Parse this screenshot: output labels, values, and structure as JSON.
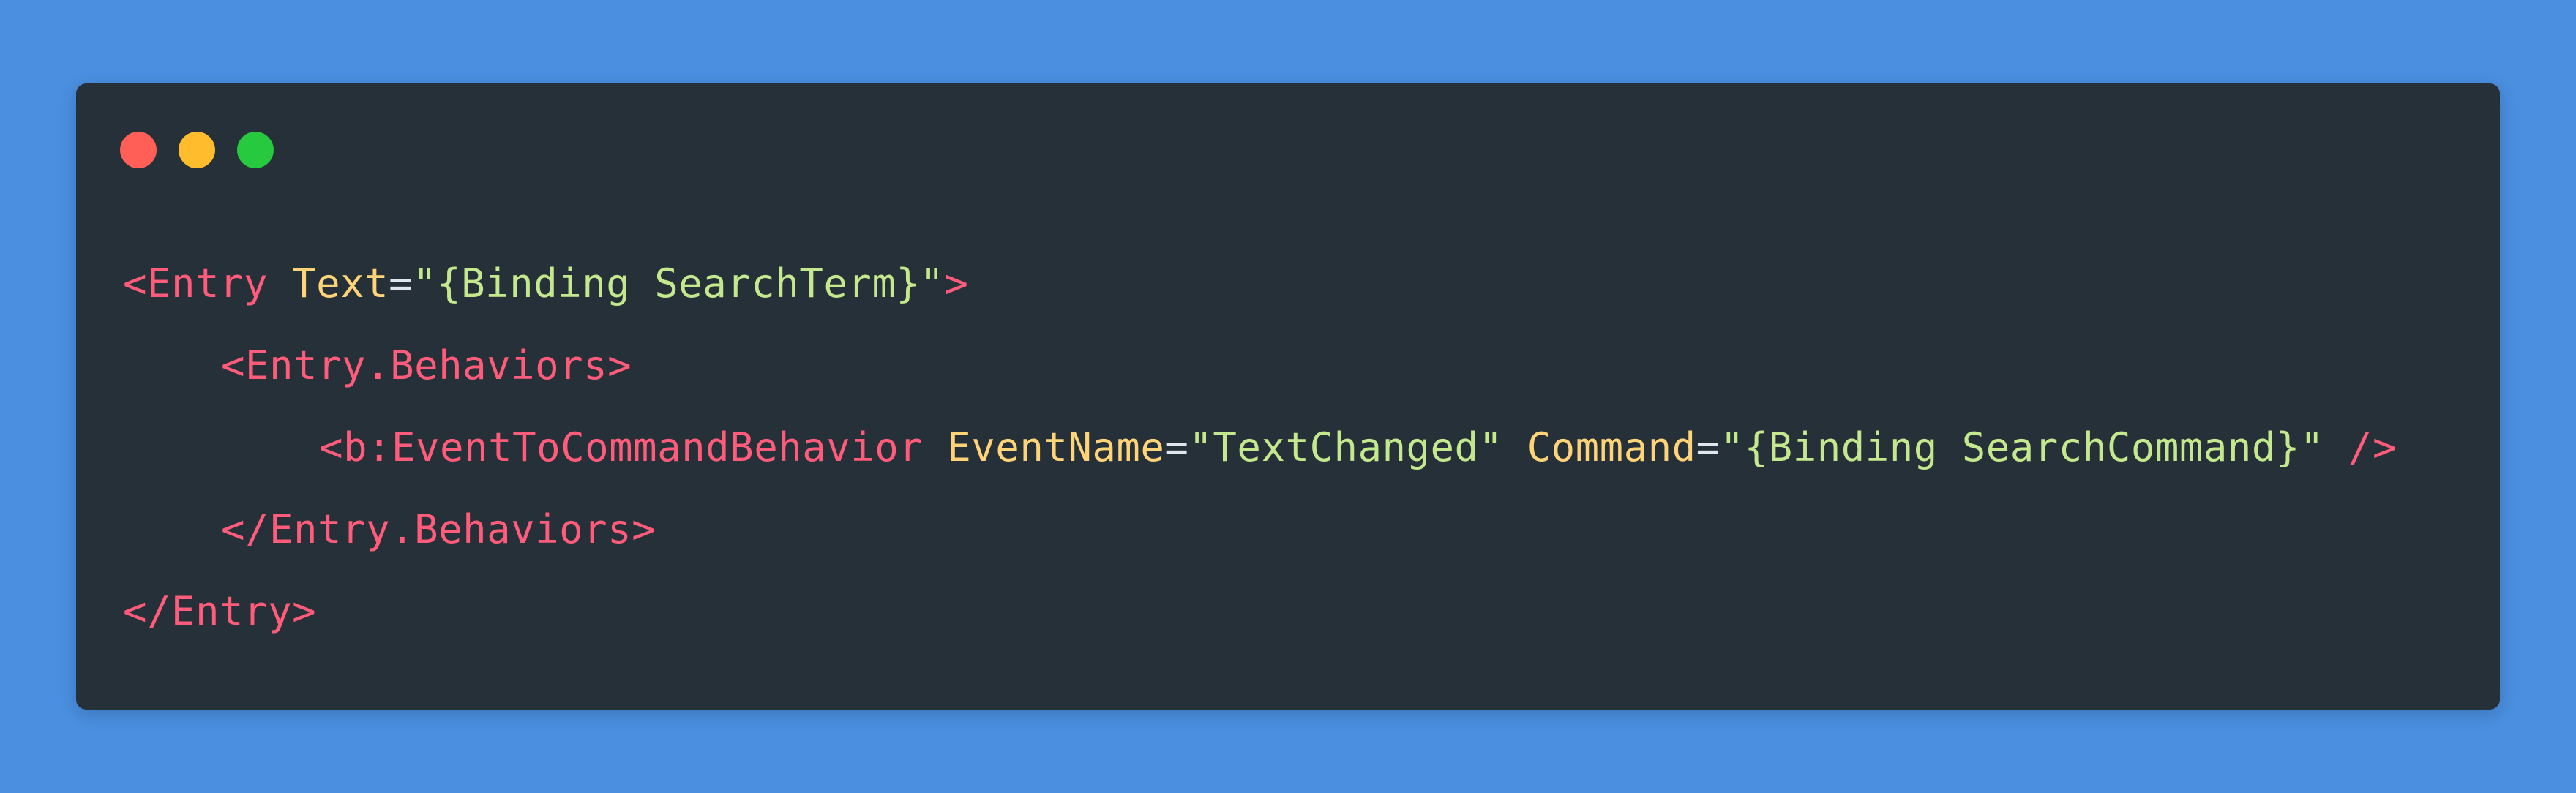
{
  "colors": {
    "background": "#4a8fe0",
    "window": "#263038",
    "close": "#ff5f56",
    "minimize": "#ffbd2e",
    "maximize": "#27c93f",
    "tag": "#ff5b7a",
    "attr": "#ffd479",
    "value": "#c3e88d",
    "punct": "#e0e6ee"
  },
  "window_controls": {
    "close": "close-dot",
    "minimize": "minimize-dot",
    "maximize": "maximize-dot"
  },
  "code_lines": [
    {
      "indent": 0,
      "tokens": [
        {
          "type": "tag",
          "text": "<Entry "
        },
        {
          "type": "attr",
          "text": "Text"
        },
        {
          "type": "punct",
          "text": "="
        },
        {
          "type": "value",
          "text": "\"{Binding SearchTerm}\""
        },
        {
          "type": "tag",
          "text": ">"
        }
      ]
    },
    {
      "indent": 1,
      "tokens": [
        {
          "type": "tag",
          "text": "<Entry.Behaviors>"
        }
      ]
    },
    {
      "indent": 2,
      "tokens": [
        {
          "type": "tag",
          "text": "<b:EventToCommandBehavior "
        },
        {
          "type": "attr",
          "text": "EventName"
        },
        {
          "type": "punct",
          "text": "="
        },
        {
          "type": "value",
          "text": "\"TextChanged\" "
        },
        {
          "type": "attr",
          "text": "Command"
        },
        {
          "type": "punct",
          "text": "="
        },
        {
          "type": "value",
          "text": "\"{Binding SearchCommand}\" "
        },
        {
          "type": "tag",
          "text": "/>"
        }
      ]
    },
    {
      "indent": 1,
      "tokens": [
        {
          "type": "tag",
          "text": "</Entry.Behaviors>"
        }
      ]
    },
    {
      "indent": 0,
      "tokens": [
        {
          "type": "tag",
          "text": "</Entry>"
        }
      ]
    }
  ]
}
